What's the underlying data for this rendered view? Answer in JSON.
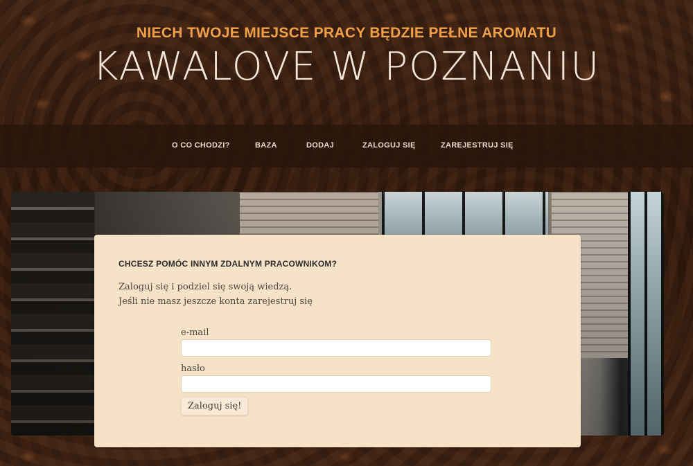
{
  "header": {
    "tagline": "NIECH TWOJE MIEJSCE PRACY BĘDZIE PEŁNE AROMATU",
    "site_title": "KAWALOVE W POZNANIU"
  },
  "nav": {
    "items": [
      {
        "label": "O CO CHODZI?"
      },
      {
        "label": "BAZA"
      },
      {
        "label": "DODAJ"
      },
      {
        "label": "ZALOGUJ SIĘ"
      },
      {
        "label": "ZAREJESTRUJ SIĘ"
      }
    ]
  },
  "login_card": {
    "heading": "CHCESZ POMÓC INNYM ZDALNYM PRACOWNIKOM?",
    "line1": "Zaloguj się i podziel się swoją wiedzą.",
    "line2": "Jeśli nie masz jeszcze konta zarejestruj się",
    "email_label": "e-mail",
    "email_value": "",
    "password_label": "hasło",
    "password_value": "",
    "submit_label": "Zaloguj się!"
  },
  "colors": {
    "tagline": "#f0a04b",
    "title": "#f3e6d8",
    "card_bg": "#f6e2c7",
    "navbar_bg": "#28140a"
  }
}
